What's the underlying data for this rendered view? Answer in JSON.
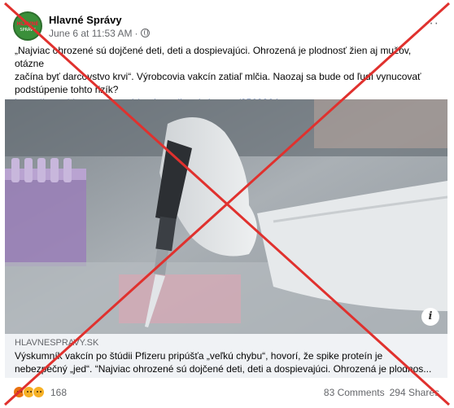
{
  "page": {
    "name": "Hlavné Správy",
    "avatar_text_top": "HLAVNÉ",
    "avatar_text_bottom": "SPRÁVY"
  },
  "post": {
    "timestamp": "June 6 at 11:53 AM",
    "separator": "·",
    "text_line1": "„Najviac ohrozené sú dojčené deti, deti a dospievajúci. Ohrozená je plodnosť žien aj mužov, otázne",
    "text_line2": "začína byť darcovstvo krvi“. Výrobcovia vakcín zatiaľ mlčia. Naozaj sa bude od ľudí vynucovať",
    "text_line3": "podstúpenie tohto rizík?",
    "link": "https://www.hlavnespravy.sk/vyskumnik-vakcin-po.../2563864"
  },
  "link_preview": {
    "domain": "HLAVNESPRAVY.SK",
    "headline_line1": "Výskumník vakcín po štúdii Pfizeru pripúšťa „veľkú chybu“, hovorí, že spike proteín je",
    "headline_line2": "nebezpečný „jed“. “Najviac ohrozené sú dojčené deti, deti a dospievajúci. Ohrozená je plodnos..."
  },
  "reactions": {
    "count": "168"
  },
  "stats": {
    "comments": "83 Comments",
    "shares": "294 Shares"
  },
  "icons": {
    "info": "i",
    "more": "···"
  },
  "colors": {
    "cross": "#e0312e",
    "link": "#385898",
    "preview_bg": "#f0f2f5"
  }
}
